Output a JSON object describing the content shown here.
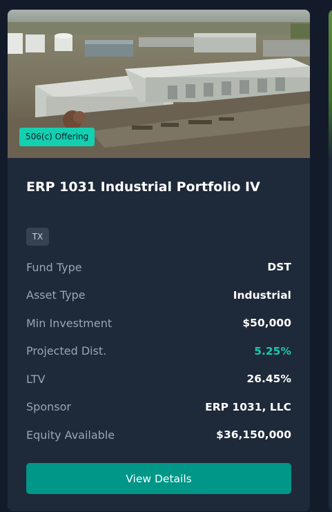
{
  "card": {
    "badge": "506(c) Offering",
    "title": "ERP 1031 Industrial Portfolio IV",
    "state": "TX",
    "details": [
      {
        "label": "Fund Type",
        "value": "DST",
        "color": "#ffffff"
      },
      {
        "label": "Asset Type",
        "value": "Industrial",
        "color": "#ffffff"
      },
      {
        "label": "Min Investment",
        "value": "$50,000",
        "color": "#ffffff"
      },
      {
        "label": "Projected Dist.",
        "value": "5.25%",
        "color": "#19c9ad"
      },
      {
        "label": "LTV",
        "value": "26.45%",
        "color": "#ffffff"
      },
      {
        "label": "Sponsor",
        "value": "ERP 1031, LLC",
        "color": "#ffffff"
      },
      {
        "label": "Equity Available",
        "value": "$36,150,000",
        "color": "#ffffff"
      }
    ],
    "button_label": "View Details",
    "image_icon": "industrial-aerial-photo"
  },
  "colors": {
    "page_background": "#131b2a",
    "card_background": "#1e2939",
    "badge": "#14cfb0",
    "button": "#009688",
    "accent_text": "#19c9ad"
  }
}
